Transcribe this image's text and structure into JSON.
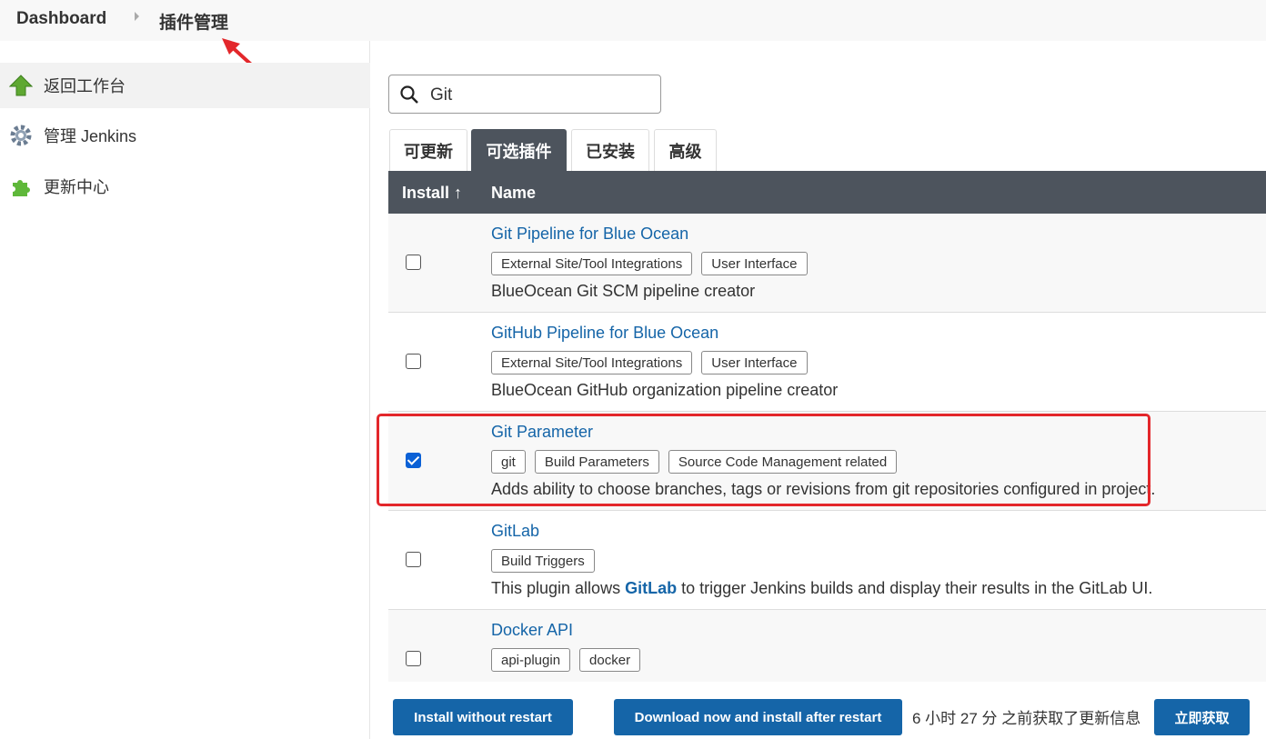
{
  "breadcrumb": {
    "dashboard": "Dashboard",
    "current": "插件管理"
  },
  "sidebar": {
    "items": [
      {
        "label": "返回工作台",
        "icon": "up-arrow-icon"
      },
      {
        "label": "管理 Jenkins",
        "icon": "gear-icon"
      },
      {
        "label": "更新中心",
        "icon": "puzzle-icon"
      }
    ]
  },
  "search": {
    "value": "Git"
  },
  "tabs": [
    {
      "label": "可更新"
    },
    {
      "label": "可选插件"
    },
    {
      "label": "已安装"
    },
    {
      "label": "高级"
    }
  ],
  "table": {
    "install_header": "Install ↑",
    "name_header": "Name",
    "rows": [
      {
        "name": "Git Pipeline for Blue Ocean",
        "tags": [
          "External Site/Tool Integrations",
          "User Interface"
        ],
        "desc": "BlueOcean Git SCM pipeline creator",
        "checked": false
      },
      {
        "name": "GitHub Pipeline for Blue Ocean",
        "tags": [
          "External Site/Tool Integrations",
          "User Interface"
        ],
        "desc": "BlueOcean GitHub organization pipeline creator",
        "checked": false
      },
      {
        "name": "Git Parameter",
        "tags": [
          "git",
          "Build Parameters",
          "Source Code Management related"
        ],
        "desc": "Adds ability to choose branches, tags or revisions from git repositories configured in project.",
        "checked": true
      },
      {
        "name": "GitLab",
        "tags": [
          "Build Triggers"
        ],
        "desc_pre": "This plugin allows ",
        "desc_link": "GitLab",
        "desc_post": " to trigger Jenkins builds and display their results in the GitLab UI.",
        "checked": false
      },
      {
        "name": "Docker API",
        "tags": [
          "api-plugin",
          "docker"
        ],
        "checked": false
      }
    ]
  },
  "footer": {
    "install_without_restart": "Install without restart",
    "download_install_after_restart": "Download now and install after restart",
    "update_info": "6 小时 27 分 之前获取了更新信息",
    "fetch_now": "立即获取"
  },
  "colors": {
    "accent": "#1565a8",
    "header": "#4d545d",
    "highlight": "#e3272b",
    "checkbox": "#0b61d6"
  }
}
